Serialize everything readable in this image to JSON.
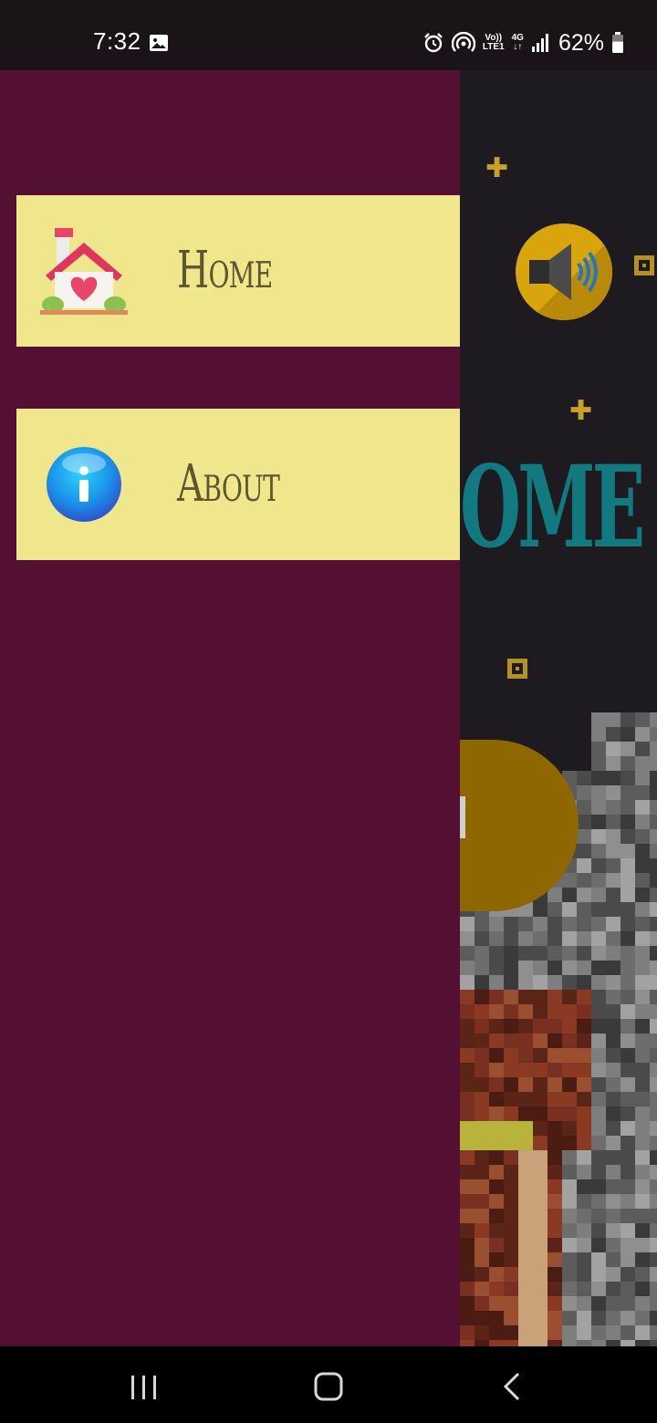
{
  "status_bar": {
    "time": "7:32",
    "network_top": "Vo))",
    "network_bottom": "LTE1",
    "data_type": "4G",
    "battery_percent": "62%",
    "icons": [
      "image-icon",
      "alarm-icon",
      "hotspot-icon",
      "volte-icon",
      "data-4g-icon",
      "signal-icon",
      "battery-icon"
    ],
    "battery_level": 0.62
  },
  "drawer": {
    "background_color": "#541032",
    "item_color": "#f0e68c",
    "items": [
      {
        "label": "Home",
        "icon": "house-heart-icon"
      },
      {
        "label": "About",
        "icon": "info-icon"
      }
    ]
  },
  "background_screen": {
    "title_visible": "OME",
    "title_color": "#117a80",
    "accent_color": "#d8a50c",
    "icons": [
      "speaker-icon",
      "sparkle-icon",
      "square-dot-icon"
    ]
  },
  "nav_bar": {
    "buttons": [
      "recent-apps-icon",
      "home-icon",
      "back-icon"
    ]
  }
}
